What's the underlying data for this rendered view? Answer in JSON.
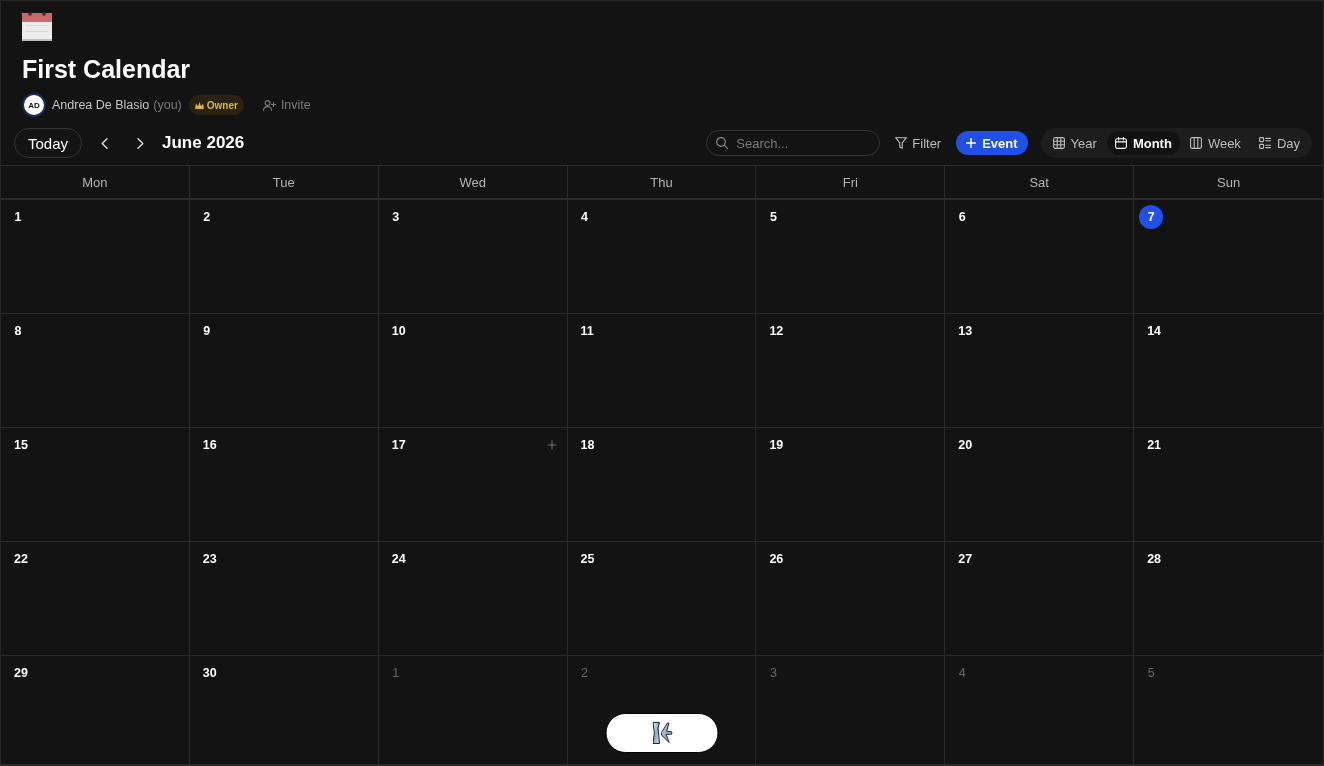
{
  "calendar_header": {
    "title": "First Calendar",
    "member": {
      "initials": "AD",
      "name": "Andrea De Blasio",
      "you_label": "(you)",
      "role": "Owner"
    },
    "invite": "Invite"
  },
  "toolbar": {
    "today": "Today",
    "period": "June 2026",
    "search": {
      "placeholder": "Search..."
    },
    "filter": "Filter",
    "add_event": "Event",
    "views": [
      {
        "kind": "year",
        "label": "Year",
        "selected": false
      },
      {
        "kind": "month",
        "label": "Month",
        "selected": true
      },
      {
        "kind": "week",
        "label": "Week",
        "selected": false
      },
      {
        "kind": "day",
        "label": "Day",
        "selected": false
      }
    ]
  },
  "month_grid": {
    "weekdays": [
      "Mon",
      "Tue",
      "Wed",
      "Thu",
      "Fri",
      "Sat",
      "Sun"
    ],
    "weeks": [
      {
        "days": [
          {
            "date": "1",
            "in_month": true,
            "today": false,
            "hovered": false
          },
          {
            "date": "2",
            "in_month": true,
            "today": false,
            "hovered": false
          },
          {
            "date": "3",
            "in_month": true,
            "today": false,
            "hovered": false
          },
          {
            "date": "4",
            "in_month": true,
            "today": false,
            "hovered": false
          },
          {
            "date": "5",
            "in_month": true,
            "today": false,
            "hovered": false
          },
          {
            "date": "6",
            "in_month": true,
            "today": false,
            "hovered": false
          },
          {
            "date": "7",
            "in_month": true,
            "today": true,
            "hovered": false
          }
        ]
      },
      {
        "days": [
          {
            "date": "8",
            "in_month": true,
            "today": false,
            "hovered": false
          },
          {
            "date": "9",
            "in_month": true,
            "today": false,
            "hovered": false
          },
          {
            "date": "10",
            "in_month": true,
            "today": false,
            "hovered": false
          },
          {
            "date": "11",
            "in_month": true,
            "today": false,
            "hovered": false
          },
          {
            "date": "12",
            "in_month": true,
            "today": false,
            "hovered": false
          },
          {
            "date": "13",
            "in_month": true,
            "today": false,
            "hovered": false
          },
          {
            "date": "14",
            "in_month": true,
            "today": false,
            "hovered": false
          }
        ]
      },
      {
        "days": [
          {
            "date": "15",
            "in_month": true,
            "today": false,
            "hovered": false
          },
          {
            "date": "16",
            "in_month": true,
            "today": false,
            "hovered": false
          },
          {
            "date": "17",
            "in_month": true,
            "today": false,
            "hovered": true
          },
          {
            "date": "18",
            "in_month": true,
            "today": false,
            "hovered": false
          },
          {
            "date": "19",
            "in_month": true,
            "today": false,
            "hovered": false
          },
          {
            "date": "20",
            "in_month": true,
            "today": false,
            "hovered": false
          },
          {
            "date": "21",
            "in_month": true,
            "today": false,
            "hovered": false
          }
        ]
      },
      {
        "days": [
          {
            "date": "22",
            "in_month": true,
            "today": false,
            "hovered": false
          },
          {
            "date": "23",
            "in_month": true,
            "today": false,
            "hovered": false
          },
          {
            "date": "24",
            "in_month": true,
            "today": false,
            "hovered": false
          },
          {
            "date": "25",
            "in_month": true,
            "today": false,
            "hovered": false
          },
          {
            "date": "26",
            "in_month": true,
            "today": false,
            "hovered": false
          },
          {
            "date": "27",
            "in_month": true,
            "today": false,
            "hovered": false
          },
          {
            "date": "28",
            "in_month": true,
            "today": false,
            "hovered": false
          }
        ]
      },
      {
        "days": [
          {
            "date": "29",
            "in_month": true,
            "today": false,
            "hovered": false
          },
          {
            "date": "30",
            "in_month": true,
            "today": false,
            "hovered": false
          },
          {
            "date": "1",
            "in_month": false,
            "today": false,
            "hovered": false
          },
          {
            "date": "2",
            "in_month": false,
            "today": false,
            "hovered": false
          },
          {
            "date": "3",
            "in_month": false,
            "today": false,
            "hovered": false
          },
          {
            "date": "4",
            "in_month": false,
            "today": false,
            "hovered": false
          },
          {
            "date": "5",
            "in_month": false,
            "today": false,
            "hovered": false
          }
        ]
      }
    ]
  }
}
